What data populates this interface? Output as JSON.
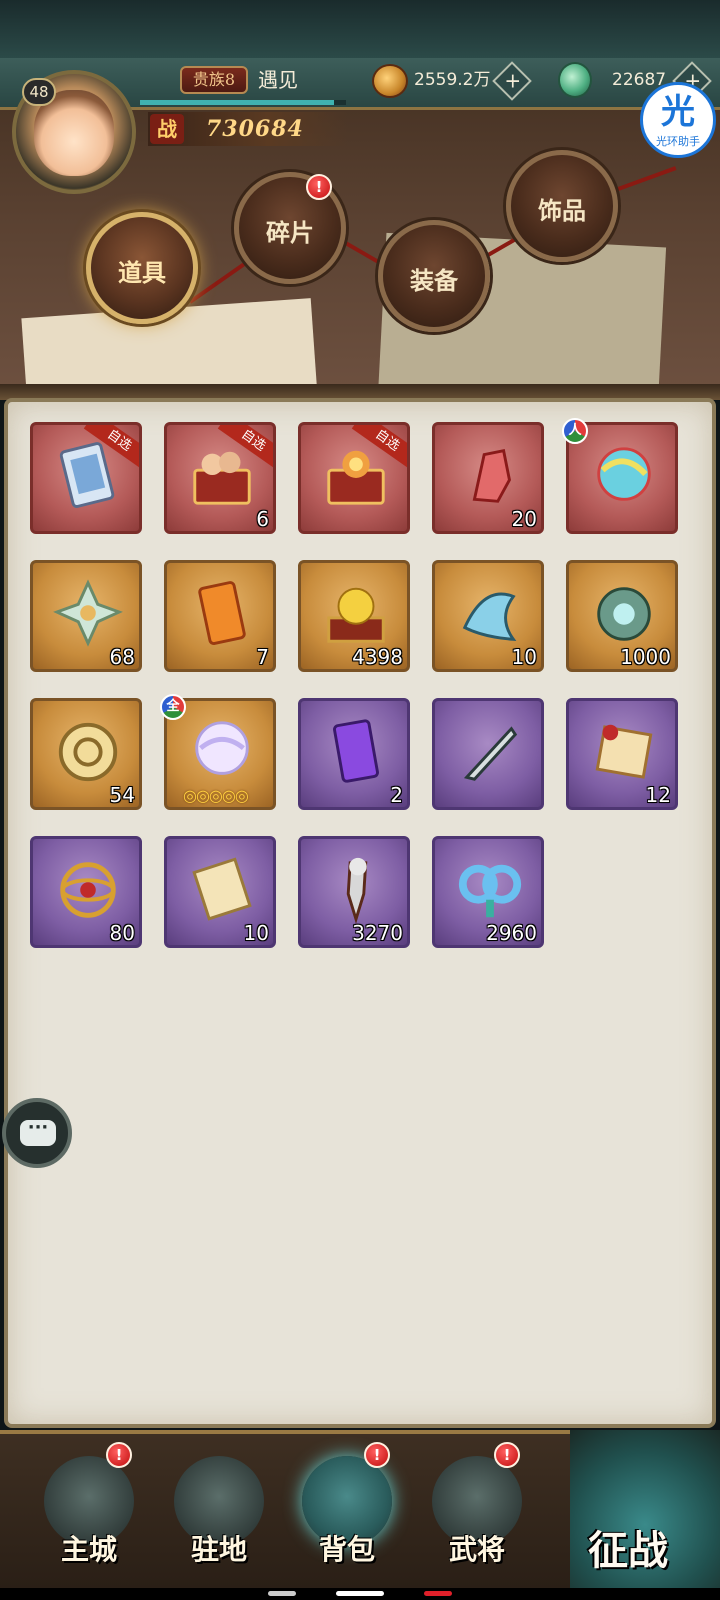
{
  "header": {
    "level": "48",
    "title_badge": "贵族8",
    "player_name": "遇见",
    "xp_progress": 0.94,
    "power_icon_text": "战",
    "power": "730684",
    "gold": "2559.2万",
    "jade": "22687",
    "plus_symbol": "+"
  },
  "helper": {
    "glyph": "光",
    "label": "光环助手"
  },
  "categories": [
    {
      "label": "道具",
      "active": true,
      "alert": false
    },
    {
      "label": "碎片",
      "active": false,
      "alert": true
    },
    {
      "label": "装备",
      "active": false,
      "alert": false
    },
    {
      "label": "饰品",
      "active": false,
      "alert": false
    }
  ],
  "alert_symbol": "!",
  "inventory": [
    {
      "rarity": "red",
      "icon": "hero-card-select-icon",
      "tag": "自选",
      "qty": ""
    },
    {
      "rarity": "red",
      "icon": "hero-chest-select-icon",
      "tag": "自选",
      "qty": "6"
    },
    {
      "rarity": "red",
      "icon": "treasure-chest-select-icon",
      "tag": "自选",
      "qty": ""
    },
    {
      "rarity": "red",
      "icon": "red-beast-figurine-icon",
      "tag": "",
      "qty": "20"
    },
    {
      "rarity": "red",
      "icon": "rainbow-orb-icon",
      "tag": "",
      "qty": "",
      "mark": "人"
    },
    {
      "rarity": "gold",
      "icon": "jade-star-emblem-icon",
      "tag": "",
      "qty": "68"
    },
    {
      "rarity": "gold",
      "icon": "orange-token-icon",
      "tag": "",
      "qty": "7"
    },
    {
      "rarity": "gold",
      "icon": "golden-pearl-box-icon",
      "tag": "",
      "qty": "4398"
    },
    {
      "rarity": "gold",
      "icon": "spirit-fish-icon",
      "tag": "",
      "qty": "10"
    },
    {
      "rarity": "gold",
      "icon": "bronze-vessel-icon",
      "tag": "",
      "qty": "1000"
    },
    {
      "rarity": "gold",
      "icon": "gold-coin-icon",
      "tag": "",
      "qty": "54"
    },
    {
      "rarity": "gold",
      "icon": "white-orb-icon",
      "tag": "",
      "qty": "",
      "mark": "全",
      "stars": "◎◎◎◎◎"
    },
    {
      "rarity": "purple",
      "icon": "purple-token-icon",
      "tag": "",
      "qty": "2"
    },
    {
      "rarity": "purple",
      "icon": "blade-icon",
      "tag": "",
      "qty": ""
    },
    {
      "rarity": "purple",
      "icon": "sealed-letter-icon",
      "tag": "",
      "qty": "12"
    },
    {
      "rarity": "purple",
      "icon": "armillary-sphere-icon",
      "tag": "",
      "qty": "80"
    },
    {
      "rarity": "purple",
      "icon": "scroll-icon",
      "tag": "",
      "qty": "10"
    },
    {
      "rarity": "purple",
      "icon": "beast-dagger-icon",
      "tag": "",
      "qty": "3270"
    },
    {
      "rarity": "purple",
      "icon": "blue-knot-icon",
      "tag": "",
      "qty": "2960"
    }
  ],
  "chat": {
    "icon": "chat-icon",
    "glyph": "···"
  },
  "bottom_nav": [
    {
      "label": "主城",
      "icon": "castle-icon",
      "alert": true,
      "active": false
    },
    {
      "label": "驻地",
      "icon": "stronghold-icon",
      "alert": false,
      "active": false
    },
    {
      "label": "背包",
      "icon": "backpack-chest-icon",
      "alert": true,
      "active": true
    },
    {
      "label": "武将",
      "icon": "general-helmet-icon",
      "alert": true,
      "active": false
    }
  ],
  "campaign_button": {
    "label": "征战",
    "icon": "sword-icon"
  },
  "colors": {
    "red_rarity": "#b45a58",
    "gold_rarity": "#c88c3c",
    "purple_rarity": "#7e5ea4",
    "accent": "#d6b26a"
  }
}
